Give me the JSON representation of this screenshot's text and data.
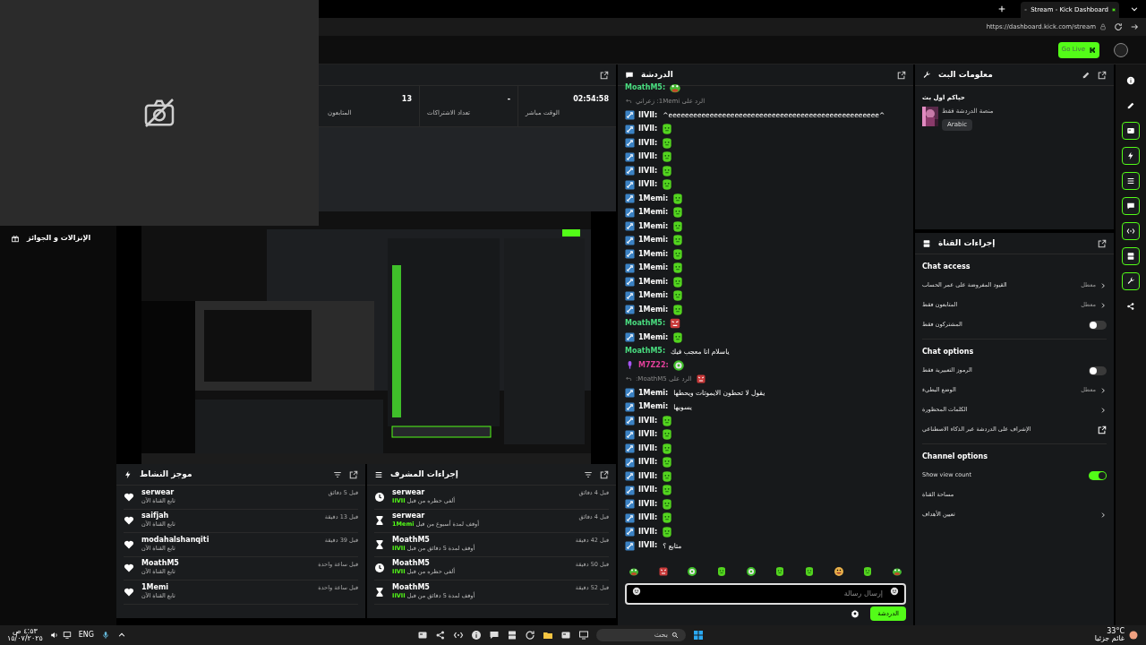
{
  "browser": {
    "tab_title": "Stream - Kick Dashboard",
    "url": "https://dashboard.kick.com/stream"
  },
  "header": {
    "go_live": "Go Live"
  },
  "sidebar": {
    "items": [
      {
        "label": "الإنزالات و الجوائز"
      }
    ]
  },
  "stats": [
    {
      "value": "02:54:58",
      "label": "الوقت مباشر"
    },
    {
      "value": "-",
      "label": "تعداد الاشتراكات"
    },
    {
      "value": "13",
      "label": "المتابعون"
    }
  ],
  "activity_feed": {
    "title": "موجز النشاط",
    "items": [
      {
        "user": "serwear",
        "detail": "تابع القناة الآن",
        "time": "قبل 5 دقائق"
      },
      {
        "user": "saifjah",
        "detail": "تابع القناة الآن",
        "time": "قبل 13 دقيقة"
      },
      {
        "user": "modahalshanqiti",
        "detail": "تابع القناة الآن",
        "time": "قبل 39 دقيقة"
      },
      {
        "user": "MoathM5",
        "detail": "تابع القناة الآن",
        "time": "قبل ساعة واحدة"
      },
      {
        "user": "1Memi",
        "detail": "تابع القناة الآن",
        "time": "قبل ساعة واحدة"
      }
    ]
  },
  "mod_actions": {
    "title": "إجراءات المشرف",
    "items": [
      {
        "kind": "unban",
        "user": "serwear",
        "action": "ألغي حظره من قبل",
        "moderator": "IIVII",
        "time": "قبل 4 دقائق"
      },
      {
        "kind": "timeout",
        "user": "serwear",
        "action": "أوقف لمدة أسبوع من قبل",
        "moderator": "1Memi",
        "time": "قبل 4 دقائق"
      },
      {
        "kind": "timeout",
        "user": "MoathM5",
        "action": "أوقف لمدة 5 دقائق من قبل",
        "moderator": "IIVII",
        "time": "قبل 42 دقيقة"
      },
      {
        "kind": "unban",
        "user": "MoathM5",
        "action": "ألغي حظره من قبل",
        "moderator": "IIVII",
        "time": "قبل 50 دقيقة"
      },
      {
        "kind": "timeout",
        "user": "MoathM5",
        "action": "أوقف لمدة 5 دقائق من قبل",
        "moderator": "IIVII",
        "time": "قبل 52 دقيقة"
      }
    ]
  },
  "chat": {
    "title": "الدردشة",
    "placeholder": "إرسال رسالة",
    "send": "الدردشة",
    "messages": [
      {
        "kind": "message",
        "user": "MoathM5:",
        "color": "#4ade80",
        "emote": {
          "kind": "pepe"
        }
      },
      {
        "kind": "reply",
        "text": "الرد على 1Memi: زعراني"
      },
      {
        "kind": "message",
        "user": "IIVII:",
        "color": "#ffffff",
        "badge": {
          "kind": "mod"
        },
        "text": "^eeeeeeeeeeeeeeeeeeeeeeeeeeeeeeeeeeeeeeeeeeeeeeeeeee^"
      },
      {
        "kind": "message",
        "user": "IIVII:",
        "color": "#ffffff",
        "badge": {
          "kind": "mod"
        },
        "emote": {
          "kind": "blob"
        }
      },
      {
        "kind": "message",
        "user": "IIVII:",
        "color": "#ffffff",
        "badge": {
          "kind": "mod"
        },
        "emote": {
          "kind": "blob"
        }
      },
      {
        "kind": "message",
        "user": "IIVII:",
        "color": "#ffffff",
        "badge": {
          "kind": "mod"
        },
        "emote": {
          "kind": "blob"
        }
      },
      {
        "kind": "message",
        "user": "IIVII:",
        "color": "#ffffff",
        "badge": {
          "kind": "mod"
        },
        "emote": {
          "kind": "blob"
        }
      },
      {
        "kind": "message",
        "user": "IIVII:",
        "color": "#ffffff",
        "badge": {
          "kind": "mod"
        },
        "emote": {
          "kind": "blob"
        }
      },
      {
        "kind": "message",
        "user": "1Memi:",
        "color": "#ffffff",
        "badge": {
          "kind": "mod"
        },
        "emote": {
          "kind": "blob"
        }
      },
      {
        "kind": "message",
        "user": "1Memi:",
        "color": "#ffffff",
        "badge": {
          "kind": "mod"
        },
        "emote": {
          "kind": "blob"
        }
      },
      {
        "kind": "message",
        "user": "1Memi:",
        "color": "#ffffff",
        "badge": {
          "kind": "mod"
        },
        "emote": {
          "kind": "blob"
        }
      },
      {
        "kind": "message",
        "user": "1Memi:",
        "color": "#ffffff",
        "badge": {
          "kind": "mod"
        },
        "emote": {
          "kind": "blob"
        }
      },
      {
        "kind": "message",
        "user": "1Memi:",
        "color": "#ffffff",
        "badge": {
          "kind": "mod"
        },
        "emote": {
          "kind": "blob"
        }
      },
      {
        "kind": "message",
        "user": "1Memi:",
        "color": "#ffffff",
        "badge": {
          "kind": "mod"
        },
        "emote": {
          "kind": "blob"
        }
      },
      {
        "kind": "message",
        "user": "1Memi:",
        "color": "#ffffff",
        "badge": {
          "kind": "mod"
        },
        "emote": {
          "kind": "blob"
        }
      },
      {
        "kind": "message",
        "user": "1Memi:",
        "color": "#ffffff",
        "badge": {
          "kind": "mod"
        },
        "emote": {
          "kind": "blob"
        }
      },
      {
        "kind": "message",
        "user": "1Memi:",
        "color": "#ffffff",
        "badge": {
          "kind": "mod"
        },
        "emote": {
          "kind": "blob"
        }
      },
      {
        "kind": "message",
        "user": "MoathM5:",
        "color": "#4ade80",
        "emote": {
          "kind": "angry"
        }
      },
      {
        "kind": "message",
        "user": "1Memi:",
        "color": "#ffffff",
        "badge": {
          "kind": "mod"
        },
        "emote": {
          "kind": "blob"
        }
      },
      {
        "kind": "message",
        "user": "MoathM5:",
        "color": "#4ade80",
        "text": "ياسلام انا معجب فيك"
      },
      {
        "kind": "message",
        "user": "M7Z22:",
        "color": "#e0409a",
        "badge": {
          "kind": "mic"
        },
        "emote": {
          "kind": "dizzy"
        }
      },
      {
        "kind": "reply",
        "text": "الرد على MoathM5:",
        "emote": {
          "kind": "angry"
        }
      },
      {
        "kind": "message",
        "user": "1Memi:",
        "color": "#ffffff",
        "badge": {
          "kind": "mod"
        },
        "text": "يقول لا تحطون الايموتات ويحطها"
      },
      {
        "kind": "message",
        "user": "1Memi:",
        "color": "#ffffff",
        "badge": {
          "kind": "mod"
        },
        "text": "يسويها"
      },
      {
        "kind": "message",
        "user": "IIVII:",
        "color": "#ffffff",
        "badge": {
          "kind": "mod"
        },
        "emote": {
          "kind": "blob"
        }
      },
      {
        "kind": "message",
        "user": "IIVII:",
        "color": "#ffffff",
        "badge": {
          "kind": "mod"
        },
        "emote": {
          "kind": "blob"
        }
      },
      {
        "kind": "message",
        "user": "IIVII:",
        "color": "#ffffff",
        "badge": {
          "kind": "mod"
        },
        "emote": {
          "kind": "blob"
        }
      },
      {
        "kind": "message",
        "user": "IIVII:",
        "color": "#ffffff",
        "badge": {
          "kind": "mod"
        },
        "emote": {
          "kind": "blob"
        }
      },
      {
        "kind": "message",
        "user": "IIVII:",
        "color": "#ffffff",
        "badge": {
          "kind": "mod"
        },
        "emote": {
          "kind": "blob"
        }
      },
      {
        "kind": "message",
        "user": "IIVII:",
        "color": "#ffffff",
        "badge": {
          "kind": "mod"
        },
        "emote": {
          "kind": "blob"
        }
      },
      {
        "kind": "message",
        "user": "IIVII:",
        "color": "#ffffff",
        "badge": {
          "kind": "mod"
        },
        "emote": {
          "kind": "blob"
        }
      },
      {
        "kind": "message",
        "user": "IIVII:",
        "color": "#ffffff",
        "badge": {
          "kind": "mod"
        },
        "emote": {
          "kind": "blob"
        }
      },
      {
        "kind": "message",
        "user": "IIVII:",
        "color": "#ffffff",
        "badge": {
          "kind": "mod"
        },
        "emote": {
          "kind": "blob"
        }
      },
      {
        "kind": "message",
        "user": "IIVII:",
        "color": "#ffffff",
        "badge": {
          "kind": "mod"
        },
        "text": "متابع ؟"
      }
    ],
    "emote_bar": [
      {
        "kind": "pepe"
      },
      {
        "kind": "angry"
      },
      {
        "kind": "dizzy"
      },
      {
        "kind": "blob"
      },
      {
        "kind": "dizzy"
      },
      {
        "kind": "blob"
      },
      {
        "kind": "blob"
      },
      {
        "kind": "smile"
      },
      {
        "kind": "blob"
      },
      {
        "kind": "pepe"
      }
    ]
  },
  "stream_info": {
    "title": "معلومات البث",
    "stream_title": "حياكم اول بث",
    "category": "منصة الدردشة فقط",
    "tags": [
      "Arabic"
    ]
  },
  "channel_actions": {
    "title": "إجراءات القناة",
    "sections": [
      {
        "heading": "Chat access",
        "rows": [
          {
            "kind": "link",
            "label": "القيود المفروضة على عمر الحساب",
            "value": "معطل"
          },
          {
            "kind": "link",
            "label": "المتابعون فقط",
            "value": "معطل"
          },
          {
            "kind": "toggle",
            "label": "المشتركون فقط",
            "on": false
          }
        ]
      },
      {
        "heading": "Chat options",
        "rows": [
          {
            "kind": "toggle",
            "label": "الرموز التعبيرية فقط",
            "on": false
          },
          {
            "kind": "link",
            "label": "الوضع البطيء",
            "value": "معطل"
          },
          {
            "kind": "link",
            "label": "الكلمات المحظورة"
          },
          {
            "kind": "external",
            "label": "الإشراف على الدردشة عبر الذكاء الاصطناعي"
          }
        ]
      },
      {
        "heading": "Channel options",
        "rows": [
          {
            "kind": "toggle",
            "label": "Show view count",
            "on": true
          },
          {
            "kind": "plain",
            "label": "مساحة القناة"
          },
          {
            "kind": "link",
            "label": "تعيين الأهداف"
          }
        ]
      }
    ]
  },
  "rail": [
    {
      "kind": "info",
      "outlined": false
    },
    {
      "kind": "pencil",
      "outlined": false
    },
    {
      "kind": "card",
      "outlined": true
    },
    {
      "kind": "bolt",
      "outlined": true
    },
    {
      "kind": "list",
      "outlined": true
    },
    {
      "kind": "chat",
      "outlined": true
    },
    {
      "kind": "code",
      "outlined": true
    },
    {
      "kind": "stack",
      "outlined": true
    },
    {
      "kind": "wrench",
      "outlined": true
    },
    {
      "kind": "nodes",
      "outlined": false
    }
  ],
  "taskbar": {
    "time": "٤:٥٣ ص",
    "date": "١٥/٠٧/٢٠٢٥",
    "language": "ENG",
    "search": "بحث",
    "weather_temp": "33°C",
    "weather_text": "غائم جزئيا"
  }
}
